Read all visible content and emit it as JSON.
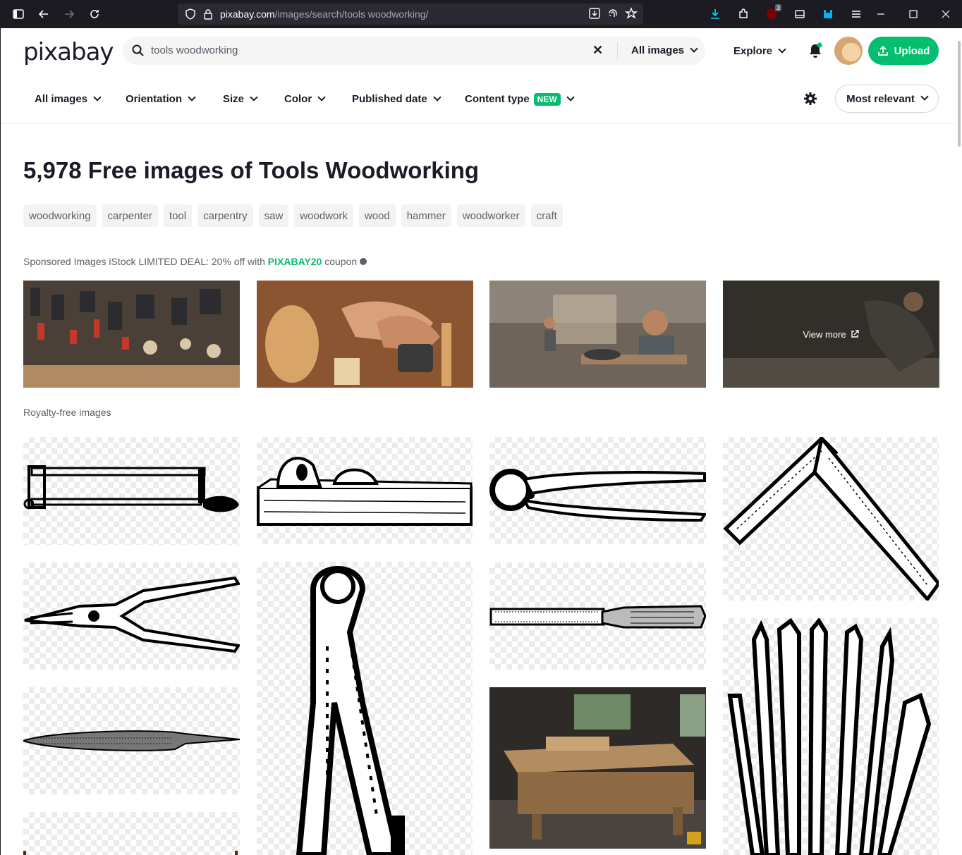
{
  "browser": {
    "url_host": "pixabay.com",
    "url_path": "/images/search/tools woodworking/",
    "extension_badge": "3"
  },
  "header": {
    "logo": "pixabay",
    "search_value": "tools woodworking",
    "search_scope": "All images",
    "explore_label": "Explore",
    "upload_label": "Upload"
  },
  "filters": {
    "items": [
      "All images",
      "Orientation",
      "Size",
      "Color",
      "Published date",
      "Content type"
    ],
    "new_badge": "NEW",
    "sort_label": "Most relevant"
  },
  "results": {
    "title": "5,978 Free images of Tools Woodworking",
    "tags": [
      "woodworking",
      "carpenter",
      "tool",
      "carpentry",
      "saw",
      "woodwork",
      "wood",
      "hammer",
      "woodworker",
      "craft"
    ]
  },
  "sponsored": {
    "prefix": "Sponsored Images iStock LIMITED DEAL: 20% off with",
    "coupon_code": "PIXABAY20",
    "suffix": "coupon",
    "view_more_label": "View more"
  },
  "royalty": {
    "label": "Royalty-free images"
  },
  "icons": {
    "search": "search-icon",
    "clear": "close-icon",
    "bell": "bell-icon",
    "upload": "upload-icon",
    "gear": "gear-icon",
    "external": "external-link-icon"
  },
  "colors": {
    "brand_green": "#02be6e",
    "text_dark": "#191b26",
    "browser_bg": "#1c1b22"
  }
}
